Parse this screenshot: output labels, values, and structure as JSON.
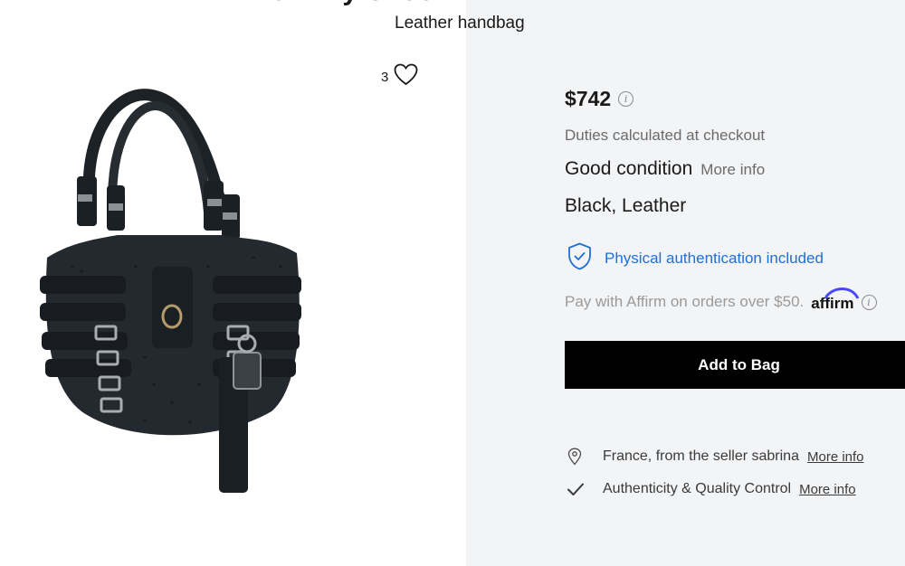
{
  "product": {
    "brand": "Jimmy Choo",
    "subtitle": "Leather handbag",
    "likes": "3"
  },
  "purchase": {
    "price": "$742",
    "duties": "Duties calculated at checkout",
    "condition": "Good condition",
    "condition_more": "More info",
    "colour_material": "Black, Leather",
    "authentication": "Physical authentication included",
    "affirm_text": "Pay with Affirm on orders over $50.",
    "affirm_logo": "affirm",
    "add_to_bag": "Add to Bag"
  },
  "info_list": [
    {
      "icon": "location-pin-icon",
      "text": "France, from the seller sabrina",
      "link": "More info"
    },
    {
      "icon": "checkmark-icon",
      "text": "Authenticity & Quality Control",
      "link": "More info"
    }
  ],
  "colors": {
    "panel_bg": "#f3f4f6",
    "auth_blue": "#1f6fd6",
    "button_bg": "#000000",
    "button_text": "#ffffff"
  }
}
